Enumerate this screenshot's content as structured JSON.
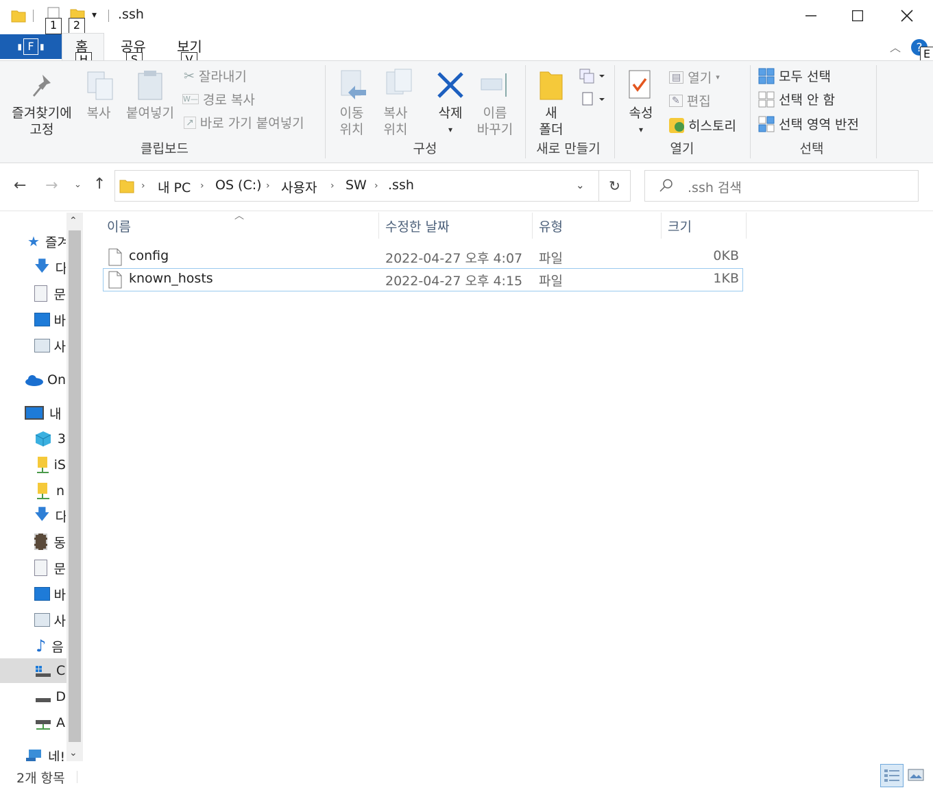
{
  "window": {
    "title": ".ssh",
    "qa_keytips": [
      "1",
      "2"
    ],
    "controls": {
      "minimize": "minimize-icon",
      "maximize": "maximize-icon",
      "close": "close-icon"
    }
  },
  "ribbon_tabs": {
    "file": "F",
    "home": "홈",
    "home_key": "H",
    "share": "공유",
    "share_key": "S",
    "view": "보기",
    "view_key": "V",
    "help_key": "E"
  },
  "ribbon": {
    "clipboard": {
      "pin_line1": "즐겨찾기에",
      "pin_line2": "고정",
      "copy": "복사",
      "paste": "붙여넣기",
      "cut": "잘라내기",
      "copy_path": "경로 복사",
      "paste_shortcut": "바로 가기 붙여넣기",
      "group": "클립보드"
    },
    "organize": {
      "move_line1": "이동",
      "move_line2": "위치",
      "copyto_line1": "복사",
      "copyto_line2": "위치",
      "delete": "삭제",
      "rename_line1": "이름",
      "rename_line2": "바꾸기",
      "group": "구성"
    },
    "new": {
      "folder_line1": "새",
      "folder_line2": "폴더",
      "group": "새로 만들기"
    },
    "open": {
      "properties": "속성",
      "open": "열기",
      "edit": "편집",
      "history": "히스토리",
      "group": "열기"
    },
    "select": {
      "select_all": "모두 선택",
      "select_none": "선택 안 함",
      "invert": "선택 영역 반전",
      "group": "선택"
    }
  },
  "address": {
    "crumbs": [
      "내 PC",
      "OS (C:)",
      "사용자",
      "SW",
      ".ssh"
    ],
    "search_placeholder": ".ssh 검색"
  },
  "navpane": {
    "items": [
      "즐겨",
      "다",
      "문",
      "바",
      "사",
      "On",
      "내",
      "3",
      "iS",
      "n",
      "다",
      "동",
      "문",
      "바",
      "사",
      "음",
      "C",
      "D",
      "A",
      "네!"
    ]
  },
  "columns": {
    "name": "이름",
    "date": "수정한 날짜",
    "type": "유형",
    "size": "크기"
  },
  "files": [
    {
      "name": "config",
      "date": "2022-04-27 오후 4:07",
      "type": "파일",
      "size": "0KB"
    },
    {
      "name": "known_hosts",
      "date": "2022-04-27 오후 4:15",
      "type": "파일",
      "size": "1KB"
    }
  ],
  "status": {
    "count": "2개 항목"
  },
  "colors": {
    "accent": "#1a5fb4",
    "selection_border": "#99c9ef",
    "ribbon_bg": "#f5f6f7"
  }
}
